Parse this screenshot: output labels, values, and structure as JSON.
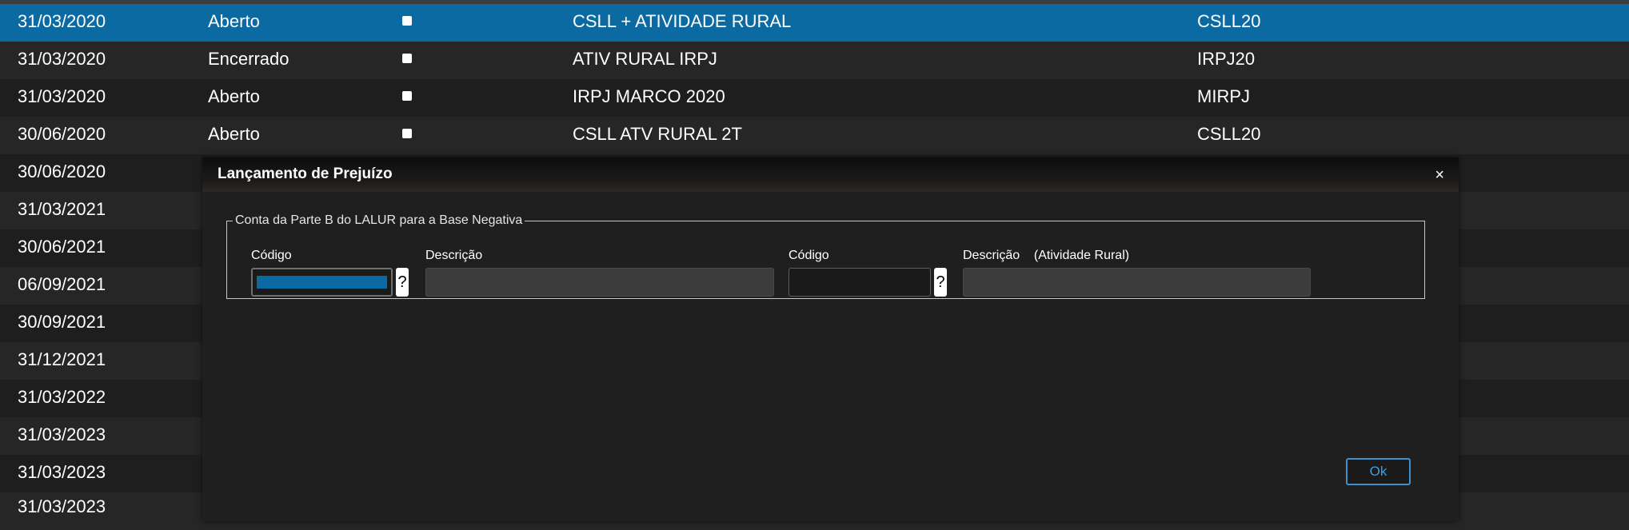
{
  "rows": [
    {
      "date": "31/03/2020",
      "status": "Aberto",
      "description": "CSLL + ATIVIDADE RURAL",
      "code": "CSLL20"
    },
    {
      "date": "31/03/2020",
      "status": "Encerrado",
      "description": "ATIV RURAL IRPJ",
      "code": "IRPJ20"
    },
    {
      "date": "31/03/2020",
      "status": "Aberto",
      "description": "IRPJ MARCO 2020",
      "code": "MIRPJ"
    },
    {
      "date": "30/06/2020",
      "status": "Aberto",
      "description": "CSLL ATV RURAL 2T",
      "code": "CSLL20"
    },
    {
      "date": "30/06/2020"
    },
    {
      "date": "31/03/2021"
    },
    {
      "date": "30/06/2021"
    },
    {
      "date": "06/09/2021"
    },
    {
      "date": "30/09/2021"
    },
    {
      "date": "31/12/2021"
    },
    {
      "date": "31/03/2022"
    },
    {
      "date": "31/03/2023"
    },
    {
      "date": "31/03/2023"
    },
    {
      "date": "31/03/2023"
    }
  ],
  "selected_row": 0,
  "modal": {
    "title": "Lançamento de Prejuízo",
    "close_icon": "×",
    "fieldset_legend": "Conta da Parte B do LALUR para a Base Negativa",
    "codigo_label": "Código",
    "descricao_label": "Descrição",
    "codigo2_label": "Código",
    "descricao2_label": "Descrição    (Atividade Rural)",
    "help_button": "?",
    "help_button2": "?",
    "ok_label": "Ok"
  },
  "colors": {
    "selection": "#0b6aa2",
    "accent_button": "#3e8fce"
  }
}
